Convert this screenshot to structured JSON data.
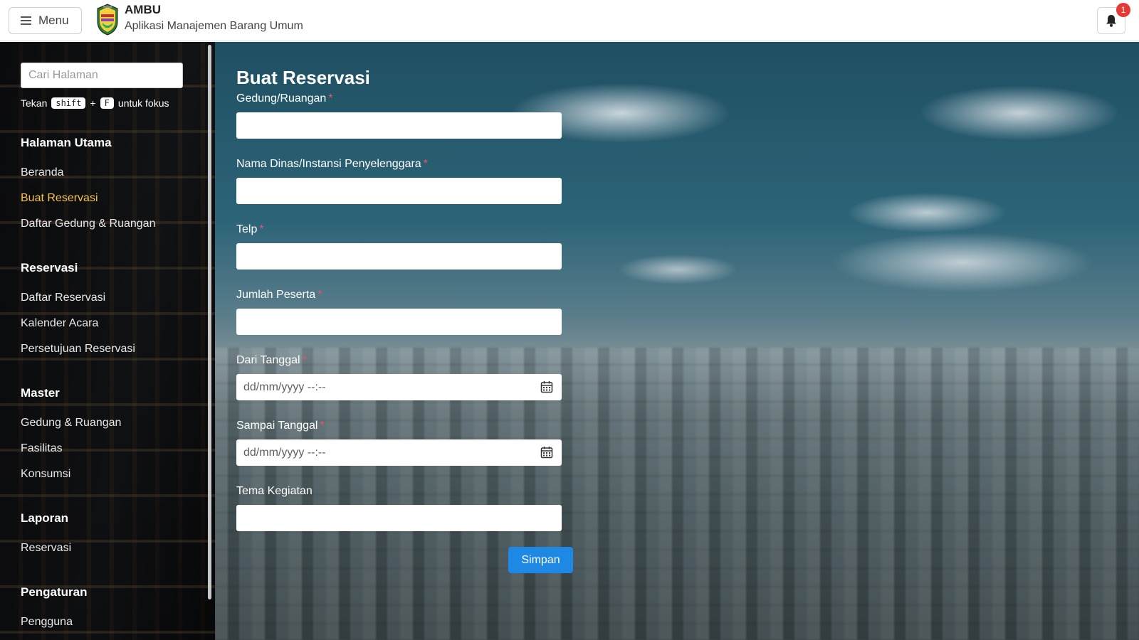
{
  "header": {
    "menu_label": "Menu",
    "app_title": "AMBU",
    "app_subtitle": "Aplikasi Manajemen Barang Umum",
    "notification_count": "1"
  },
  "sidebar": {
    "search_placeholder": "Cari Halaman",
    "hint_prefix": "Tekan",
    "hint_key1": "shift",
    "hint_plus": "+",
    "hint_key2": "F",
    "hint_suffix": "untuk fokus",
    "sections": [
      {
        "title": "Halaman Utama",
        "items": [
          "Beranda",
          "Buat Reservasi",
          "Daftar Gedung & Ruangan"
        ]
      },
      {
        "title": "Reservasi",
        "items": [
          "Daftar Reservasi",
          "Kalender Acara",
          "Persetujuan Reservasi"
        ]
      },
      {
        "title": "Master",
        "items": [
          "Gedung & Ruangan",
          "Fasilitas",
          "Konsumsi"
        ]
      },
      {
        "title": "Laporan",
        "items": [
          "Reservasi"
        ]
      },
      {
        "title": "Pengaturan",
        "items": [
          "Pengguna"
        ]
      }
    ],
    "active_item": "Buat Reservasi"
  },
  "form": {
    "title": "Buat Reservasi",
    "fields": [
      {
        "label": "Gedung/Ruangan",
        "required": "*",
        "value": "",
        "placeholder": ""
      },
      {
        "label": "Nama Dinas/Instansi Penyelenggara",
        "required": "*",
        "value": "",
        "placeholder": ""
      },
      {
        "label": "Telp",
        "required": "*",
        "value": "",
        "placeholder": ""
      },
      {
        "label": "Jumlah Peserta",
        "required": "*",
        "value": "",
        "placeholder": ""
      },
      {
        "label": "Dari Tanggal",
        "required": "*",
        "value": "",
        "placeholder": "dd/mm/yyyy --:--"
      },
      {
        "label": "Sampai Tanggal",
        "required": "*",
        "value": "",
        "placeholder": "dd/mm/yyyy --:--"
      },
      {
        "label": "Tema Kegiatan",
        "required": "",
        "value": "",
        "placeholder": ""
      }
    ],
    "submit_label": "Simpan"
  },
  "colors": {
    "accent": "#1e88e5",
    "active_nav": "#f5c24a",
    "required": "#e0576a",
    "badge": "#e53935"
  },
  "icons": {
    "menu": "hamburger-icon",
    "notification": "bell-icon",
    "date": "calendar-icon"
  }
}
